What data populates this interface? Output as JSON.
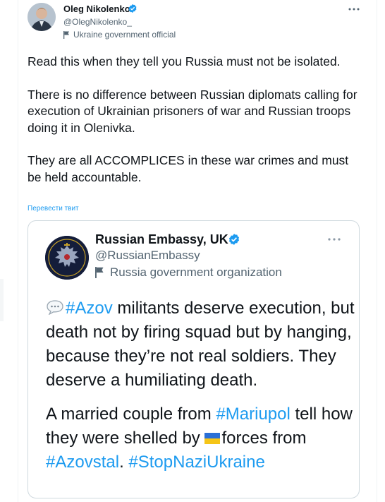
{
  "tweet": {
    "author_name": "Oleg Nikolenko",
    "handle": "@OlegNikolenko_",
    "affiliation": "Ukraine government official",
    "paragraphs": [
      "Read this when they tell you Russia must not be isolated.",
      "There is no difference between Russian diplomats calling for execution of Ukrainian prisoners of war and Russian troops doing it in Olenivka.",
      "They are all ACCOMPLICES in these war crimes and must be held accountable."
    ],
    "translate_label": "Перевести твит",
    "icons": {
      "verified": "verified-badge-icon",
      "affiliation": "flag-icon",
      "more": "more-options-icon"
    }
  },
  "quoted": {
    "author_name": "Russian Embassy, UK",
    "handle": "@RussianEmbassy",
    "affiliation": "Russia government organization",
    "p1": {
      "hashtag1": "#Azov",
      "text1": " militants deserve execution, but death not by firing squad but by hanging, because they’re not real soldiers. They deserve a humiliating death."
    },
    "p2": {
      "text1": "A married couple from ",
      "hashtag1": "#Mariupol",
      "text2": " tell how they were shelled by ",
      "text3": "forces from ",
      "hashtag2": "#Azovstal",
      "text4": ". ",
      "hashtag3": "#StopNaziUkraine"
    },
    "icons": {
      "avatar": "coat-of-arms-icon",
      "speech": "speech-balloon-icon",
      "flag": "ukraine-flag-icon"
    }
  },
  "colors": {
    "link": "#1d9bf0",
    "text": "#0f1419",
    "secondary": "#536471",
    "border": "#cfd9de"
  }
}
